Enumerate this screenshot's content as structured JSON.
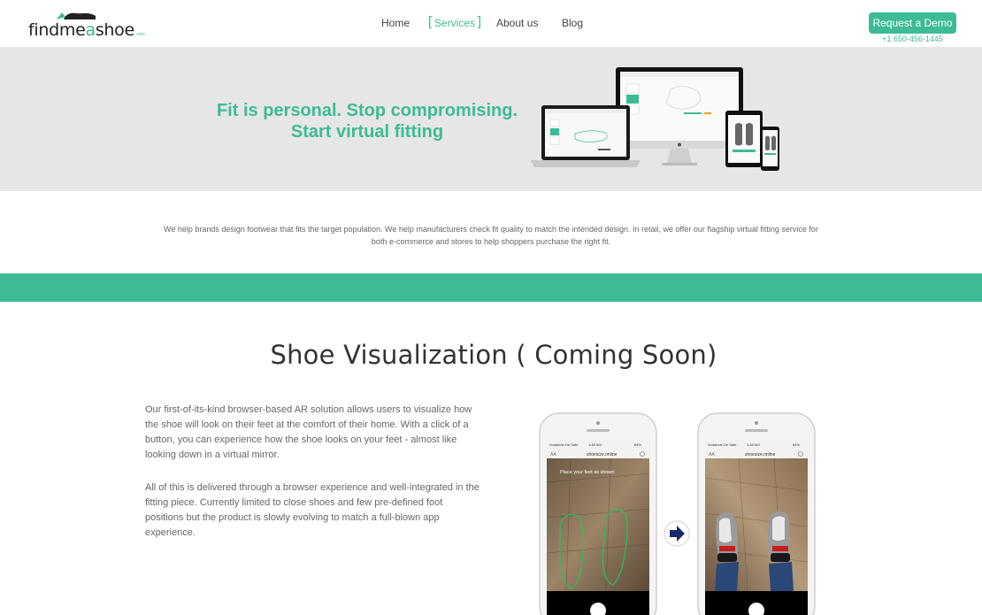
{
  "nav": {
    "logo": {
      "part1": "findme",
      "part2": "a",
      "part3": "shoe",
      "suffix": ".com"
    },
    "items": [
      {
        "label": "Home",
        "active": false
      },
      {
        "label": "Services",
        "active": true
      },
      {
        "label": "About us",
        "active": false
      },
      {
        "label": "Blog",
        "active": false
      }
    ],
    "cta": "Request a Demo",
    "phone": "+1 650-456-1445"
  },
  "hero": {
    "line1": "Fit is personal. Stop compromising.",
    "line2": "Start virtual fitting"
  },
  "intro": "We help brands design footwear that fits the target population. We help manufacturers check fit quality to match the intended design. In retail, we offer our flagship virtual fitting service for both e-commerce and stores to help shoppers purchase the right fit.",
  "section": {
    "title": "Shoe Visualization ( Coming Soon)",
    "para1": "Our first-of-its-kind browser-based AR solution allows users to visualize how the shoe will look on their feet at the comfort of their home. With a click of a button, you can experience how the shoe looks on your feet - almost like looking down in a virtual mirror.",
    "para2": "All of this is delivered through a browser experience and well-integrated in the fitting piece. Currently limited to close shoes and few pre-defined foot positions but the product is slowly evolving to match a full-blown app experience."
  },
  "phones": {
    "carrier": "Vodafone De Safe",
    "time": "1:48 AM",
    "battery": "84%",
    "url": "shoesize.online",
    "text_size_icon": "AA",
    "overlay": "Place your feet as shown",
    "arrow_icon": "arrow-right-icon"
  },
  "colors": {
    "accent": "#3dbb96",
    "hero_bg": "#e6e6e6"
  }
}
